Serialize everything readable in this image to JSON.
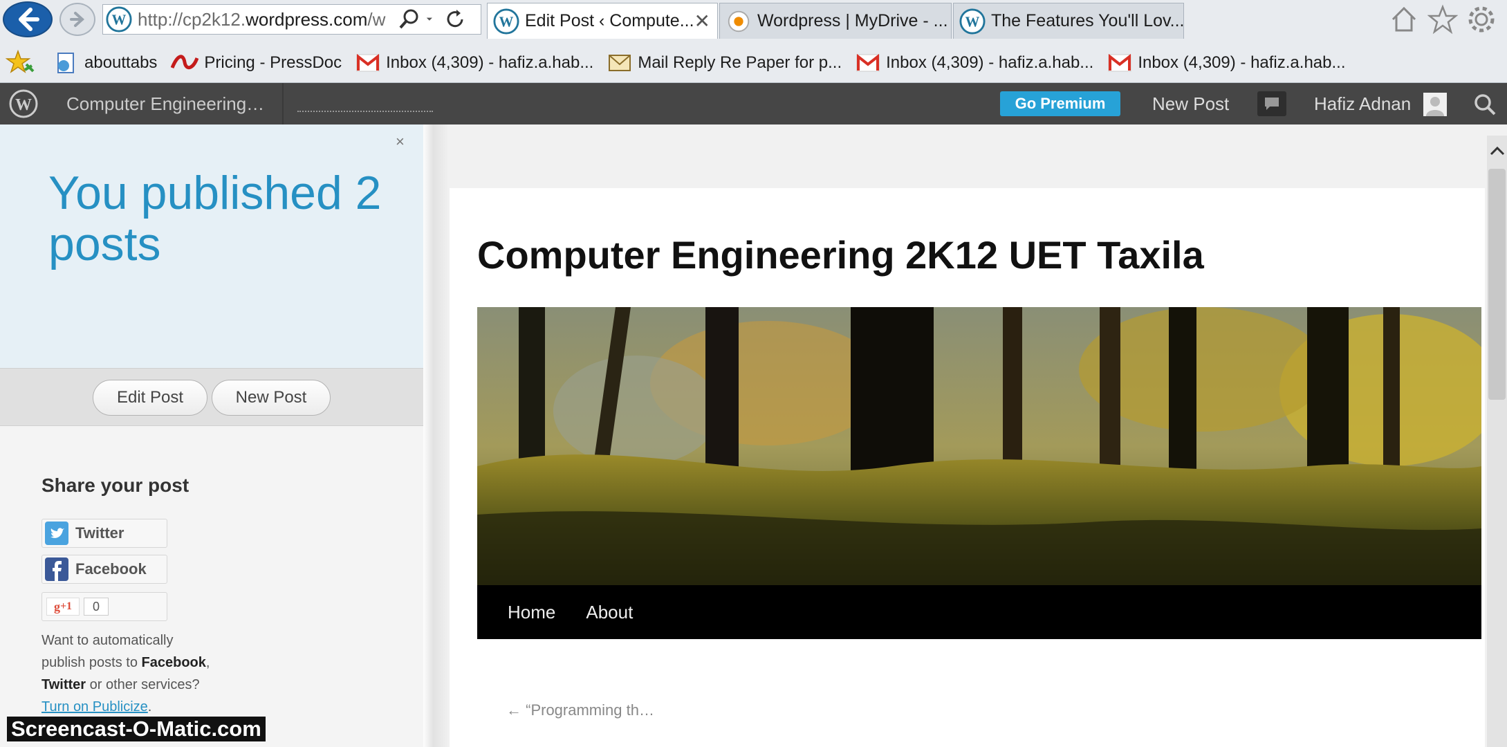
{
  "browser": {
    "address": {
      "prefix": "http://cp2k12.",
      "domain": "wordpress.com",
      "suffix": "/w"
    },
    "tabs": [
      {
        "title": "Edit Post ‹ Compute...",
        "active": true
      },
      {
        "title": "Wordpress | MyDrive - ...",
        "active": false
      },
      {
        "title": "The Features You'll Lov...",
        "active": false
      }
    ],
    "tab_close": "✕",
    "bookmarks": [
      "abouttabs",
      "Pricing - PressDoc",
      "Inbox (4,309) - hafiz.a.hab...",
      "Mail  Reply Re Paper for p...",
      "Inbox (4,309) - hafiz.a.hab...",
      "Inbox (4,309) - hafiz.a.hab..."
    ]
  },
  "adminbar": {
    "site_name": "Computer Engineering…",
    "go_premium": "Go Premium",
    "new_post": "New Post",
    "user": "Hafiz Adnan"
  },
  "left_panel": {
    "published_message": "You published 2 posts",
    "close": "×",
    "edit_post": "Edit Post",
    "new_post": "New Post",
    "share_heading": "Share your post",
    "twitter": "Twitter",
    "facebook": "Facebook",
    "gplus": "+1",
    "gplus_count": "0",
    "publicize_1": "Want to automatically",
    "publicize_2": "publish posts to ",
    "publicize_fb": "Facebook",
    "publicize_comma": ",",
    "publicize_tw": "Twitter",
    "publicize_3": " or other services?",
    "publicize_link": "Turn on Publicize",
    "publicize_period": "."
  },
  "preview": {
    "site_title": "Computer Engineering 2K12 UET Taxila",
    "nav": [
      "Home",
      "About"
    ],
    "prev_post": "← “Programming th…"
  },
  "watermark": "Screencast-O-Matic.com",
  "colors": {
    "accent": "#2690c3",
    "premium": "#27a2d7",
    "adminbar": "#464646"
  }
}
